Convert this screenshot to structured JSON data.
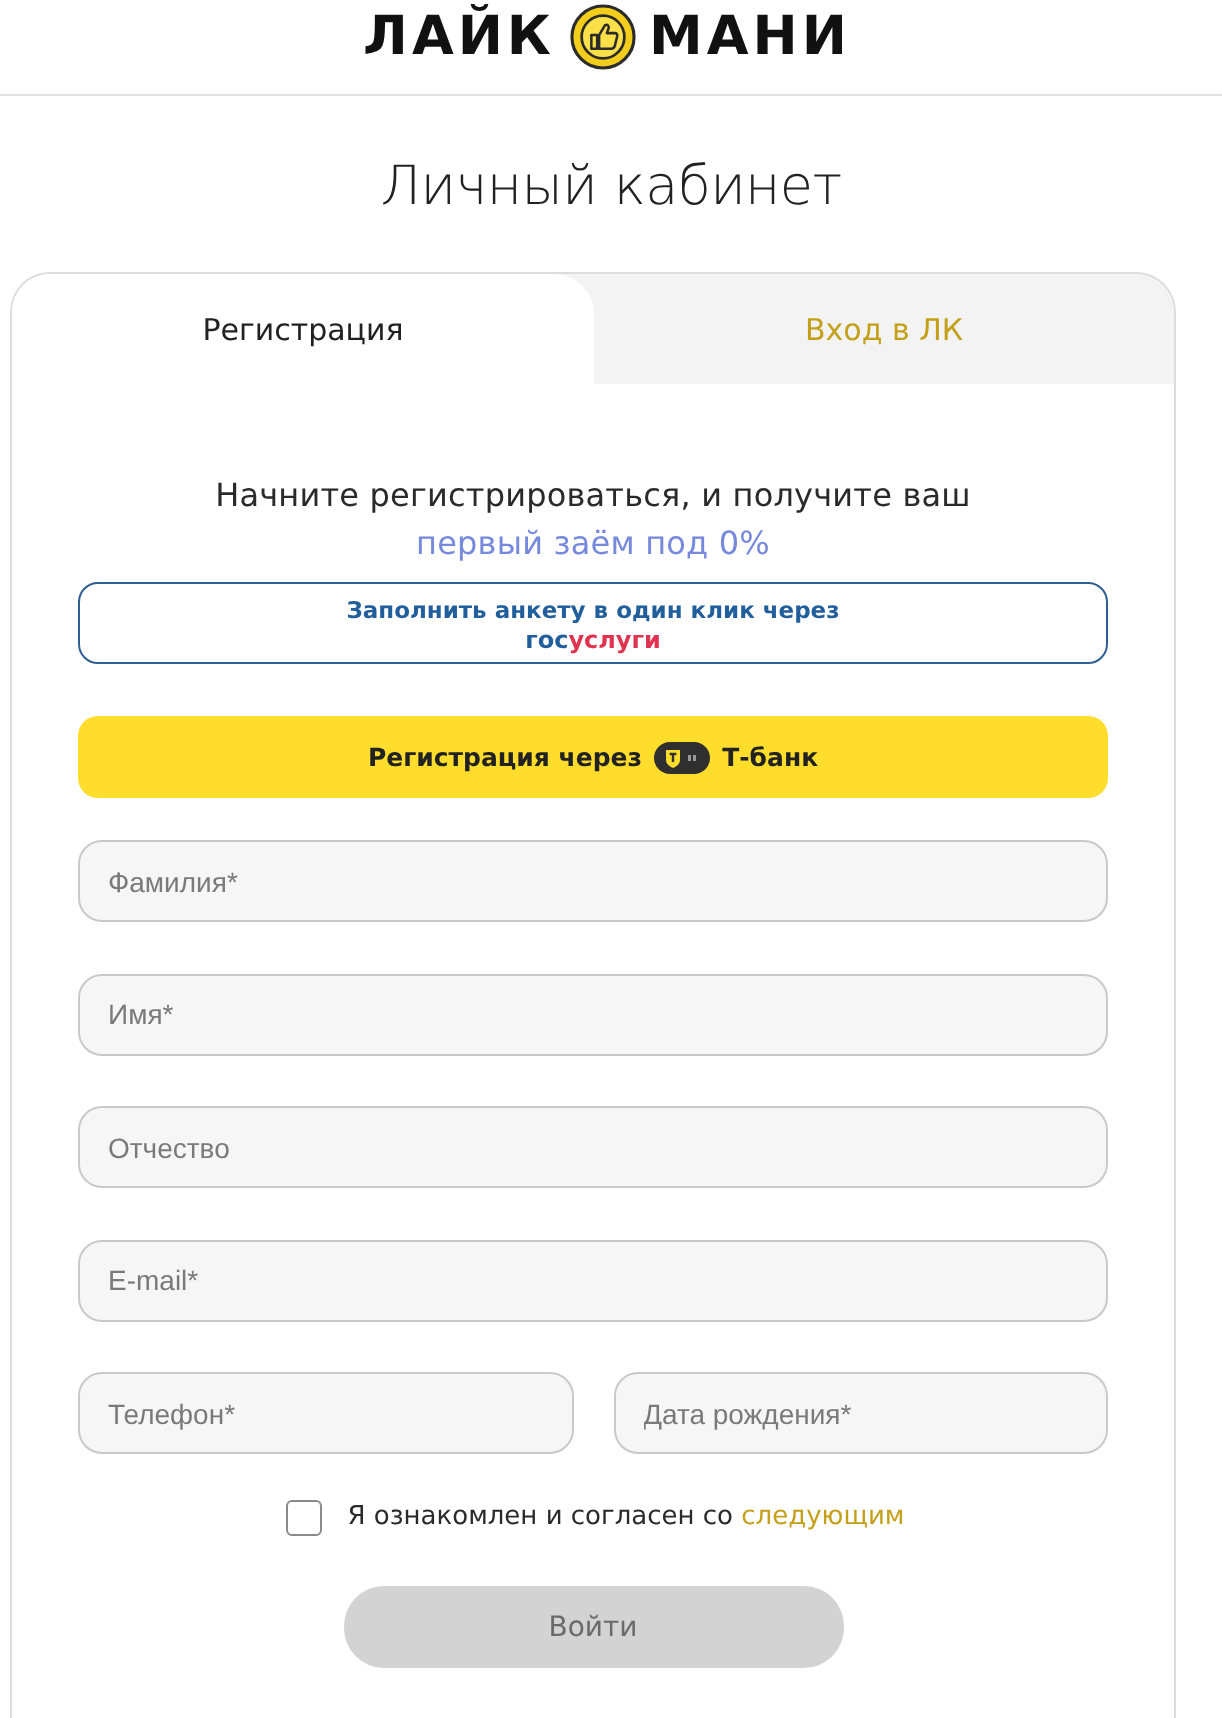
{
  "header": {
    "logo": {
      "left": "ЛАЙК",
      "right": "МАНИ"
    }
  },
  "page_title": "Личный кабинет",
  "tabs": [
    {
      "label": "Регистрация",
      "selected": true
    },
    {
      "label": "Вход в ЛК",
      "selected": false
    }
  ],
  "intro": {
    "text": "Начните регистрироваться, и получите ваш",
    "highlight": "первый заём под 0%"
  },
  "gosuslugi_button": {
    "label": "Заполнить анкету в один клик через",
    "logo_left": "гос",
    "logo_right": "услуги"
  },
  "tbank_button": {
    "label": "Регистрация через",
    "bank": "Т-банк"
  },
  "fields": [
    {
      "placeholder": "Фамилия*",
      "kind": "full"
    },
    {
      "placeholder": "Имя*",
      "kind": "full"
    },
    {
      "placeholder": "Отчество",
      "kind": "full"
    },
    {
      "placeholder": "E-mail*",
      "kind": "full"
    },
    {
      "placeholder": "Телефон*",
      "kind": "half"
    },
    {
      "placeholder": "Дата рождения*",
      "kind": "half"
    }
  ],
  "consent": {
    "checked": false,
    "text": "Я ознакомлен и согласен со",
    "link": "следующим"
  },
  "submit": {
    "label": "Войти",
    "disabled": true
  }
}
